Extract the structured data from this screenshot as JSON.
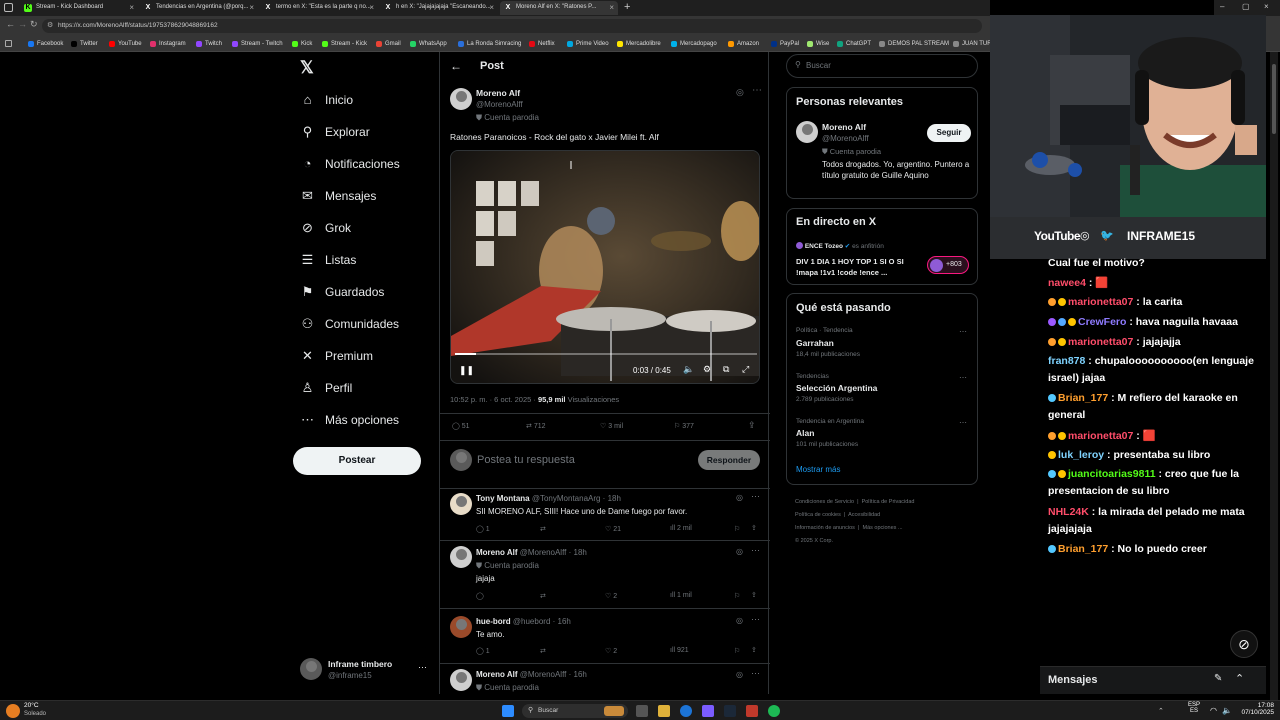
{
  "browser": {
    "tabs": [
      {
        "label": "Stream - Kick Dashboard",
        "icon": "kick-icon",
        "color": "#53fc18"
      },
      {
        "label": "Tendencias en Argentina (@porq...",
        "icon": "x-icon",
        "color": "#000000"
      },
      {
        "label": "termo en X: \"Esta es la parte q no...",
        "icon": "x-icon",
        "color": "#000000"
      },
      {
        "label": "h en X: \"Jajajajajaja \"Escaneando...",
        "icon": "x-icon",
        "color": "#000000"
      },
      {
        "label": "Moreno Alf en X: \"Ratones P...",
        "icon": "x-icon",
        "color": "#000000"
      }
    ],
    "url": "https://x.com/MorenoAlff/status/1975378629048869162",
    "bookmarks": [
      "Facebook",
      "Twitter",
      "YouTube",
      "Instagram",
      "Twitch",
      "Stream - Twitch",
      "Kick",
      "Stream - Kick",
      "Gmail",
      "WhatsApp",
      "La Ronda Simracing",
      "Netflix",
      "Prime Video",
      "Mercadolibre",
      "Mercadopago",
      "Amazon",
      "PayPal",
      "Wise",
      "ChatGPT",
      "DEMOS PAL STREAM",
      "JUAN TUR..."
    ]
  },
  "nav": {
    "items": [
      {
        "label": "Inicio",
        "icon": "home-icon",
        "glyph": "⌂"
      },
      {
        "label": "Explorar",
        "icon": "search-icon",
        "glyph": "⚲"
      },
      {
        "label": "Notificaciones",
        "icon": "bell-icon",
        "glyph": "🔔"
      },
      {
        "label": "Mensajes",
        "icon": "mail-icon",
        "glyph": "✉"
      },
      {
        "label": "Grok",
        "icon": "grok-icon",
        "glyph": "⊘"
      },
      {
        "label": "Listas",
        "icon": "list-icon",
        "glyph": "☰"
      },
      {
        "label": "Guardados",
        "icon": "bookmark-icon",
        "glyph": "⚑"
      },
      {
        "label": "Comunidades",
        "icon": "communities-icon",
        "glyph": "⚇"
      },
      {
        "label": "Premium",
        "icon": "x-icon",
        "glyph": "✕"
      },
      {
        "label": "Perfil",
        "icon": "profile-icon",
        "glyph": "♙"
      },
      {
        "label": "Más opciones",
        "icon": "more-icon",
        "glyph": "⋯"
      }
    ],
    "post_button": "Postear",
    "account_name": "Inframe timbero",
    "account_handle": "@inframe15"
  },
  "post": {
    "header_title": "Post",
    "author_name": "Moreno Alf",
    "author_handle": "@MorenoAlff",
    "parody_label": "Cuenta parodia",
    "text": "Ratones Paranoicos - Rock del gato x Javier Milei ft. Alf",
    "video_time": "0:03 / 0:45",
    "video_progress": 0.07,
    "timestamp": "10:52 p. m. · 6 oct. 2025 · ",
    "views_count": "95,9 mil",
    "views_label": "Visualizaciones",
    "replies": "51",
    "reposts": "712",
    "likes": "3 mil",
    "bookmarks": "377",
    "reply_placeholder": "Postea tu respuesta",
    "reply_button": "Responder"
  },
  "replies": [
    {
      "name": "Tony Montana",
      "handle": "@TonyMontanaArg · 18h",
      "parody": "",
      "text": "SII MORENO ALF, SIII! Hace uno de Dame fuego por favor.",
      "replies": "1",
      "reposts": "",
      "likes": "21",
      "views": "2 mil"
    },
    {
      "name": "Moreno Alf",
      "handle": "@MorenoAlff · 18h",
      "parody": "Cuenta parodia",
      "text": "jajaja",
      "replies": "",
      "reposts": "",
      "likes": "2",
      "views": "1 mil"
    },
    {
      "name": "hue-bord",
      "handle": "@huebord · 16h",
      "parody": "",
      "text": "Te amo.",
      "replies": "1",
      "reposts": "",
      "likes": "2",
      "views": "921"
    },
    {
      "name": "Moreno Alf",
      "handle": "@MorenoAlff · 16h",
      "parody": "Cuenta parodia",
      "text": "",
      "replies": "",
      "reposts": "",
      "likes": "",
      "views": ""
    }
  ],
  "right": {
    "search_placeholder": "Buscar",
    "relevant_title": "Personas relevantes",
    "relevant_name": "Moreno Alf",
    "relevant_handle": "@MorenoAlff",
    "relevant_parody": "Cuenta parodia",
    "relevant_bio": "Todos drogados. Yo, argentino. Puntero a título gratuito de Guille Aquino",
    "follow_button": "Seguir",
    "live_title": "En directo en X",
    "live_host": "ENCE Tozeo",
    "live_host_suffix": "es anfitrión",
    "live_text": "DIV 1 DIA 1 HOY TOP 1 SI O SI !mapa !1v1 !code !ence ...",
    "live_count": "+803",
    "trends_title": "Qué está pasando",
    "trends": [
      {
        "context": "Política · Tendencia",
        "name": "Garrahan",
        "count": "18,4 mil publicaciones"
      },
      {
        "context": "Tendencias",
        "name": "Selección Argentina",
        "count": "2.789 publicaciones"
      },
      {
        "context": "Tendencia en Argentina",
        "name": "Alan",
        "count": "101 mil publicaciones"
      }
    ],
    "show_more": "Mostrar más",
    "footer": [
      "Condiciones de Servicio",
      "Política de Privacidad",
      "Política de cookies",
      "Accesibilidad",
      "Información de anuncios",
      "Más opciones ...",
      "© 2025 X Corp."
    ]
  },
  "stream": {
    "socials": [
      "YouTube",
      "INFRAME15"
    ],
    "chat": [
      {
        "user": "",
        "color": "#ffffff",
        "text": "Cual fue el motivo?"
      },
      {
        "user": "nawee4",
        "color": "#ff4d6a",
        "text": ": 🟥"
      },
      {
        "user": "marionetta07",
        "color": "#ff4d6a",
        "text": ": la carita"
      },
      {
        "user": "CrewFero",
        "color": "#8f7bff",
        "text": ": hava naguila havaaa"
      },
      {
        "user": "marionetta07",
        "color": "#ff4d6a",
        "text": ": jajajajja"
      },
      {
        "user": "fran878",
        "color": "#7fd3ff",
        "text": ": chupaloooooooooo(en lenguaje israel) jajaa"
      },
      {
        "user": "Brian_177",
        "color": "#ff9f2e",
        "text": ": M refiero del karaoke en general"
      },
      {
        "user": "marionetta07",
        "color": "#ff4d6a",
        "text": ": 🟥"
      },
      {
        "user": "luk_leroy",
        "color": "#7fd3ff",
        "text": ": presentaba su libro"
      },
      {
        "user": "juancitoarias9811",
        "color": "#53fc18",
        "text": ": creo que fue la presentacion de su libro"
      },
      {
        "user": "NHL24K",
        "color": "#ff4d6a",
        "text": ": la mirada del pelado me mata jajajajaja"
      },
      {
        "user": "Brian_177",
        "color": "#ff9f2e",
        "text": ": No lo puedo creer"
      }
    ],
    "messages_label": "Mensajes"
  },
  "taskbar": {
    "weather_temp": "20°C",
    "weather_desc": "Soleado",
    "search_label": "Buscar",
    "lang": "ESP",
    "lang_sub": "ES",
    "time": "17:08",
    "date": "07/10/2025"
  }
}
